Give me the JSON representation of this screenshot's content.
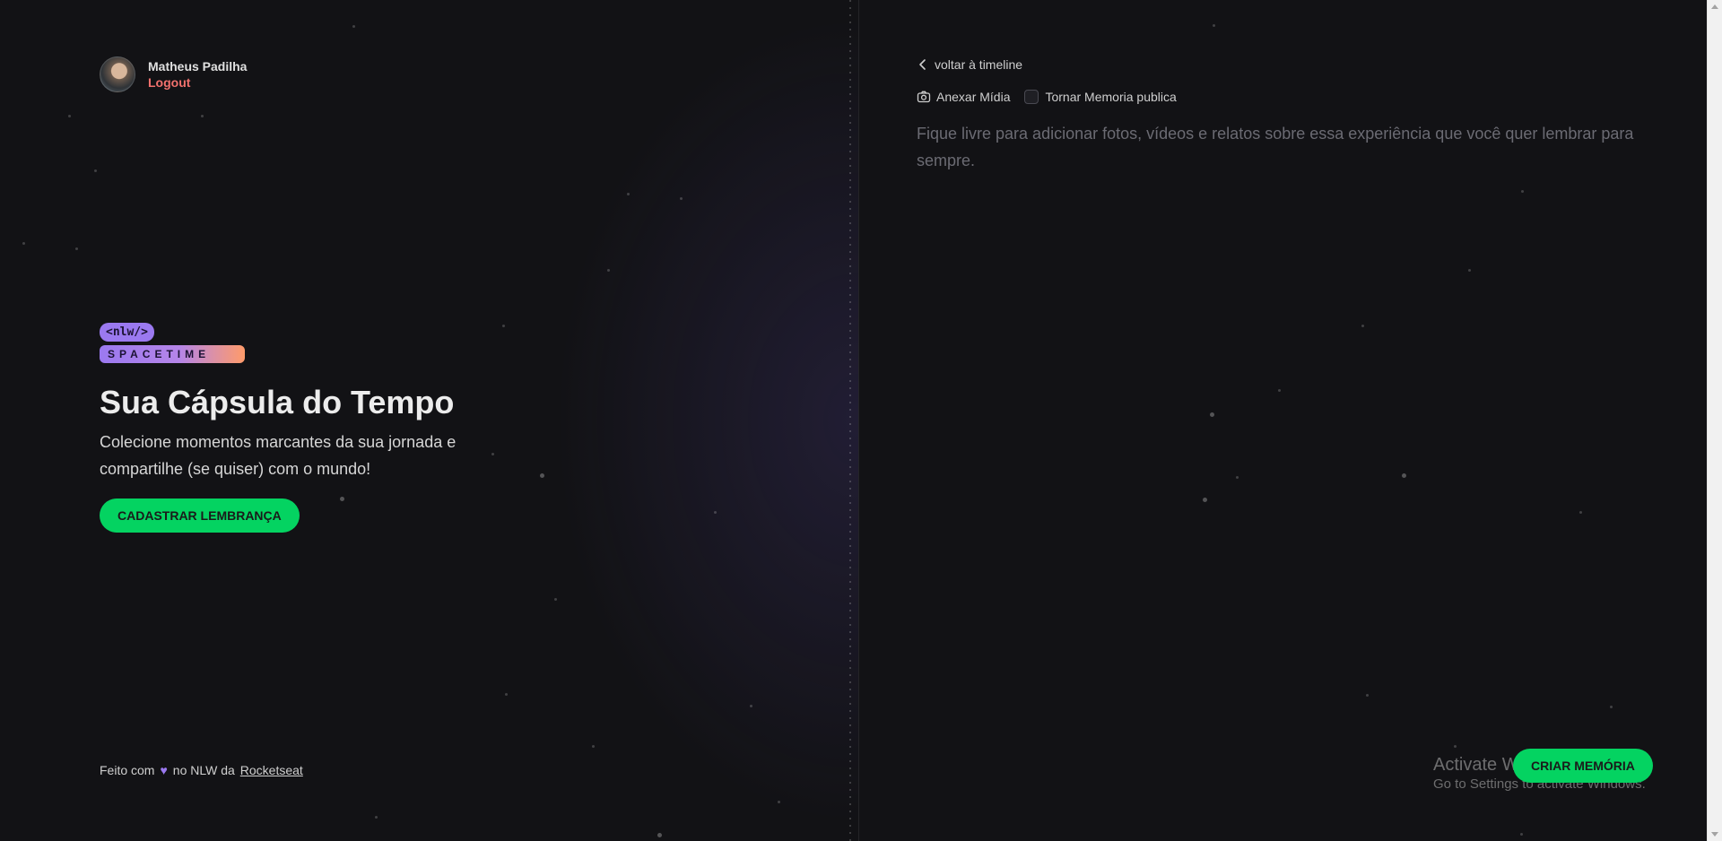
{
  "user": {
    "name": "Matheus Padilha",
    "logout_label": "Logout"
  },
  "brand": {
    "tag": "<nlw/>",
    "name": "SPACETIME"
  },
  "hero": {
    "title": "Sua Cápsula do Tempo",
    "subtitle": "Colecione momentos marcantes da sua jornada e compartilhe (se quiser) com o mundo!",
    "cta_label": "CADASTRAR LEMBRANÇA"
  },
  "footer": {
    "prefix": "Feito com",
    "middle": "no NLW da",
    "link": "Rocketseat"
  },
  "form": {
    "back_label": "voltar à timeline",
    "attach_label": "Anexar Mídia",
    "public_label": "Tornar Memoria publica",
    "public_checked": false,
    "content_value": "",
    "content_placeholder": "Fique livre para adicionar fotos, vídeos e relatos sobre essa experiência que você quer lembrar para sempre.",
    "submit_label": "CRIAR MEMÓRIA"
  },
  "os_watermark": {
    "title": "Activate Windows",
    "subtitle": "Go to Settings to activate Windows."
  },
  "colors": {
    "accent_green": "#04d361",
    "accent_purple": "#9b79f0",
    "logout_red": "#f2716d",
    "background": "#121215"
  }
}
